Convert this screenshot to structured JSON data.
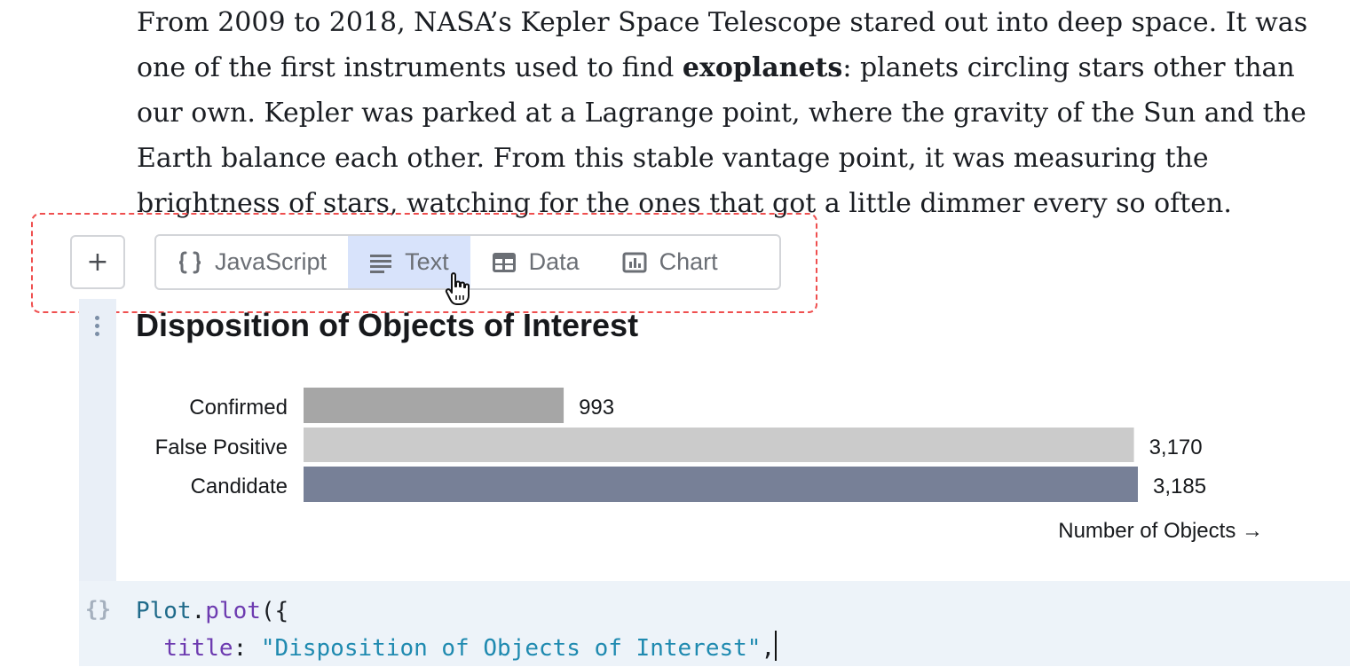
{
  "prose": {
    "line1": "From 2009 to 2018, NASA’s Kepler Space Telescope stared out into deep space. It was",
    "line2_pre": "one of the first instruments used to find ",
    "line2_bold": "exoplanets",
    "line2_post": ": planets circling stars other than",
    "line3": "our own. Kepler was parked at a Lagrange point, where the gravity of the Sun and the",
    "line4": "Earth balance each other. From this stable vantage point, it was measuring the",
    "line5": "brightness of stars, watching for the ones that got a little dimmer every so often."
  },
  "toolbar": {
    "add_label": "+",
    "types": [
      {
        "label": "JavaScript",
        "icon": "braces-icon",
        "active": false
      },
      {
        "label": "Text",
        "icon": "text-lines-icon",
        "active": true
      },
      {
        "label": "Data",
        "icon": "table-icon",
        "active": false
      },
      {
        "label": "Chart",
        "icon": "bar-chart-icon",
        "active": false
      }
    ]
  },
  "colors": {
    "dashed_outline": "#ef4f4f",
    "active_tab": "#d8e3fb",
    "gutter": "#e9eff7",
    "code_bg": "#edf3f9",
    "bar_confirmed": "#a6a6a6",
    "bar_false_positive": "#cbcbcb",
    "bar_candidate": "#778097"
  },
  "chart_data": {
    "type": "bar",
    "orientation": "horizontal",
    "title": "Disposition of Objects of Interest",
    "categories": [
      "Confirmed",
      "False Positive",
      "Candidate"
    ],
    "values": [
      993,
      3170,
      3185
    ],
    "value_labels": [
      "993",
      "3,170",
      "3,185"
    ],
    "xlabel": "Number of Objects →",
    "ylabel": "",
    "xlim": [
      0,
      3185
    ],
    "grid": false,
    "legend": "none"
  },
  "code": {
    "icon": "{}",
    "line1_obj": "Plot",
    "line1_dot": ".",
    "line1_fn": "plot",
    "line1_rest": "({",
    "line2_indent": "  ",
    "line2_key": "title",
    "line2_colon": ": ",
    "line2_str": "\"Disposition of Objects of Interest\"",
    "line2_comma": ","
  }
}
